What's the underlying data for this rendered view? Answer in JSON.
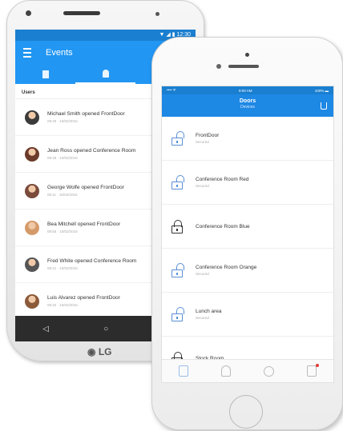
{
  "android": {
    "status_text": "▼ ◢ ▮ 12:30",
    "app_title": "Events",
    "section_label": "Users",
    "events": [
      {
        "text": "Michael Smith opened FrontDoor",
        "meta": "09:25 · 10/02/2016",
        "color": "#3b3b3b"
      },
      {
        "text": "Jean Ross opened Conference Room",
        "meta": "09:18 · 10/02/2016",
        "color": "#6b3a2a"
      },
      {
        "text": "George Wolfe opened FrontDoor",
        "meta": "09:11 · 10/02/2016",
        "color": "#7a4a3a"
      },
      {
        "text": "Bea Mitchell opened FrontDoor",
        "meta": "08:55 · 10/02/2016",
        "color": "#d49a6a"
      },
      {
        "text": "Fred White opened Conference Room",
        "meta": "08:41 · 10/02/2016",
        "color": "#555555"
      },
      {
        "text": "Luis Alvarez opened FrontDoor",
        "meta": "08:32 · 10/02/2016",
        "color": "#8a5a3a"
      }
    ],
    "nav": {
      "back": "◁",
      "home": "○",
      "recent": "□"
    },
    "brand": "LG"
  },
  "iphone": {
    "carrier": "•••• ᯤ",
    "time": "9:00 AM",
    "battery": "100% ▬",
    "title": "Doors",
    "subtitle": "Devices",
    "doors": [
      {
        "name": "FrontDoor",
        "status": "Secured",
        "locked": false
      },
      {
        "name": "Conference Room Red",
        "status": "Secured",
        "locked": false
      },
      {
        "name": "Conference Room Blue",
        "status": "",
        "locked": true
      },
      {
        "name": "Conference Room Orange",
        "status": "Secured",
        "locked": false
      },
      {
        "name": "Lunch area",
        "status": "Secured",
        "locked": false
      },
      {
        "name": "Stock Room",
        "status": "",
        "locked": true
      }
    ]
  }
}
